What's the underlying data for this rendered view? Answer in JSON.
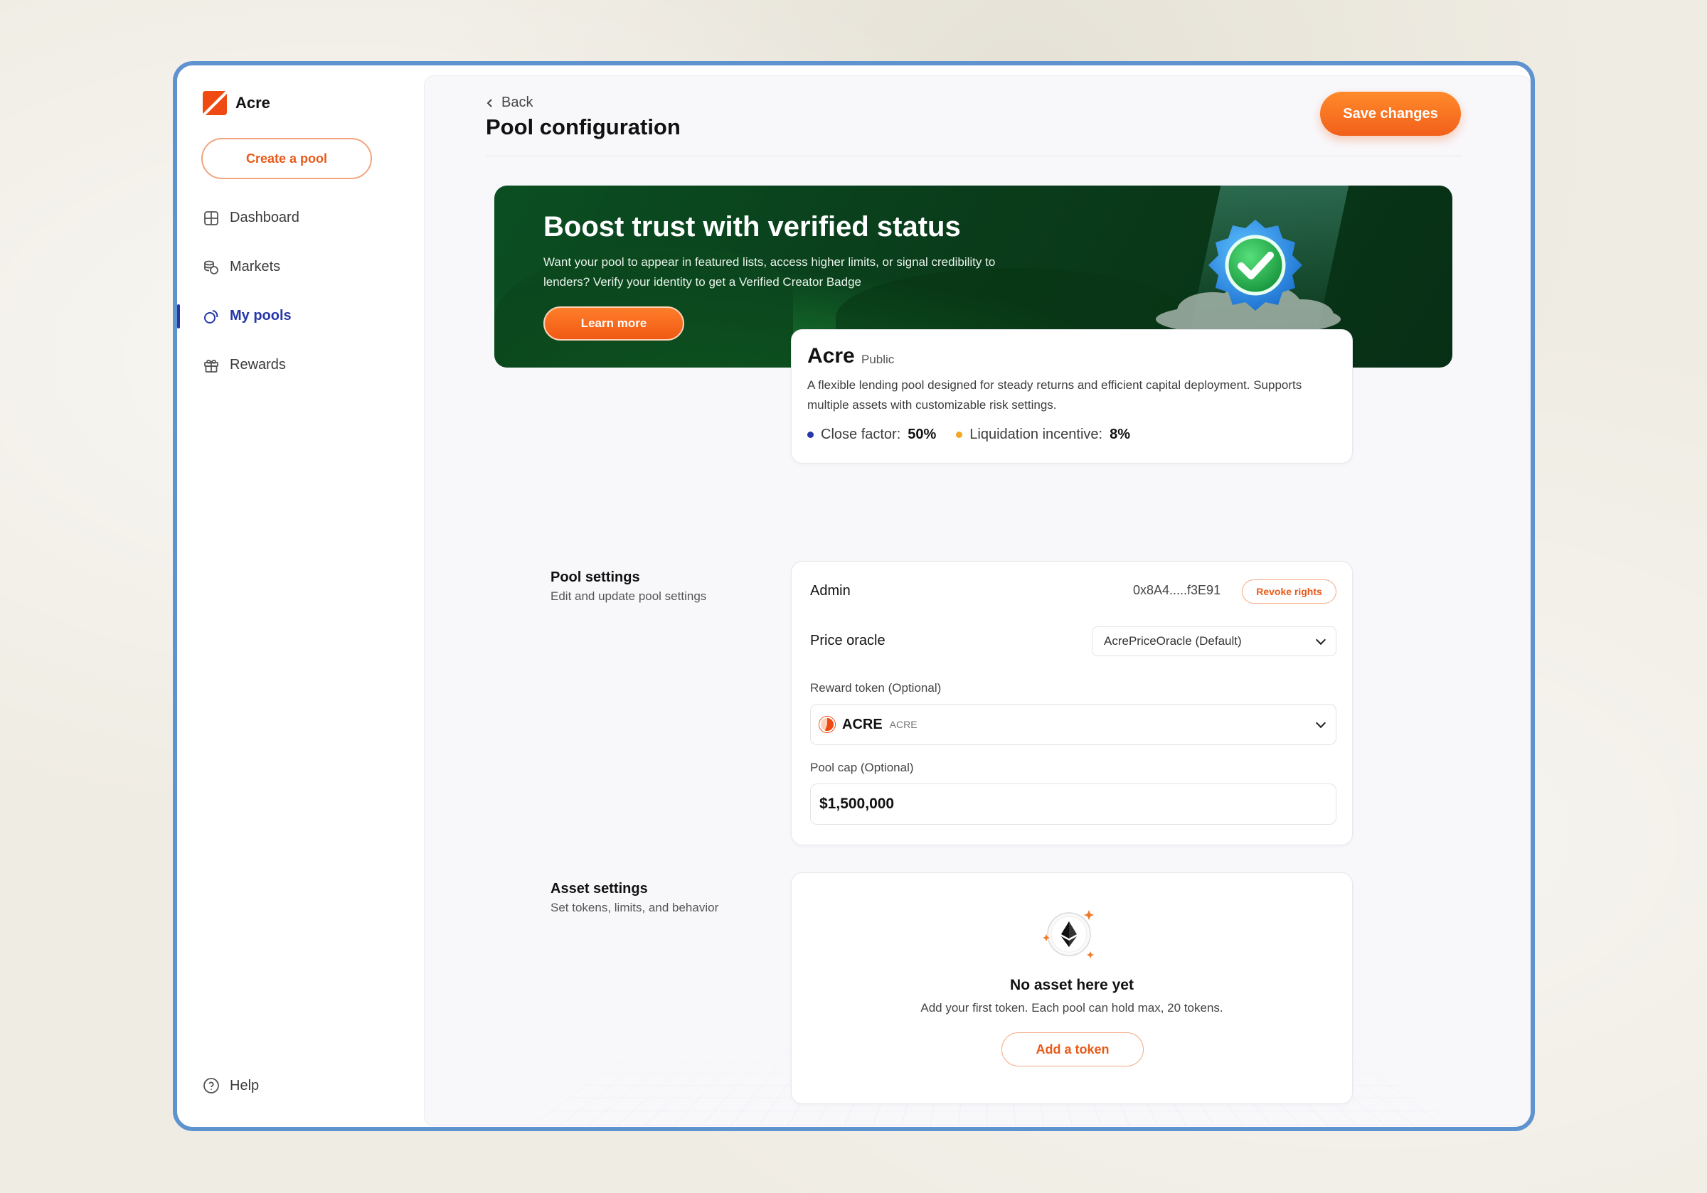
{
  "brand": {
    "name": "Acre",
    "accent": "#ef4a12",
    "nav_active_color": "#2637a8"
  },
  "sidebar": {
    "create_label": "Create a pool",
    "items": [
      {
        "label": "Dashboard",
        "icon": "grid-icon"
      },
      {
        "label": "Markets",
        "icon": "coins-icon"
      },
      {
        "label": "My pools",
        "icon": "pool-icon",
        "active": true
      },
      {
        "label": "Rewards",
        "icon": "gift-icon"
      }
    ],
    "help_label": "Help"
  },
  "header": {
    "back_label": "Back",
    "title": "Pool configuration",
    "save_label": "Save changes"
  },
  "banner": {
    "title": "Boost trust with verified status",
    "description": "Want your pool to appear in featured lists, access higher limits, or signal credibility to lenders? Verify your identity to get a Verified Creator Badge",
    "cta_label": "Learn more"
  },
  "pool": {
    "name": "Acre",
    "visibility": "Public",
    "description": "A flexible lending pool designed for steady returns and efficient capital deployment. Supports multiple assets with customizable risk settings.",
    "close_factor_label": "Close factor:",
    "close_factor_value": "50%",
    "close_factor_color": "#2637a8",
    "liquidation_label": "Liquidation incentive:",
    "liquidation_value": "8%",
    "liquidation_color": "#f5a623"
  },
  "pool_settings": {
    "title": "Pool settings",
    "subtitle": "Edit and update pool settings",
    "admin_label": "Admin",
    "admin_address": "0x8A4.....f3E91",
    "revoke_label": "Revoke rights",
    "oracle_label": "Price oracle",
    "oracle_value": "AcrePriceOracle (Default)",
    "reward_label": "Reward token (Optional)",
    "reward_symbol": "ACRE",
    "reward_sub": "ACRE",
    "cap_label": "Pool cap (Optional)",
    "cap_value": "$1,500,000"
  },
  "asset_settings": {
    "title": "Asset settings",
    "subtitle": "Set tokens, limits, and behavior",
    "empty_title": "No asset here yet",
    "empty_sub": "Add your first token. Each pool can hold max, 20 tokens.",
    "add_label": "Add a token"
  }
}
